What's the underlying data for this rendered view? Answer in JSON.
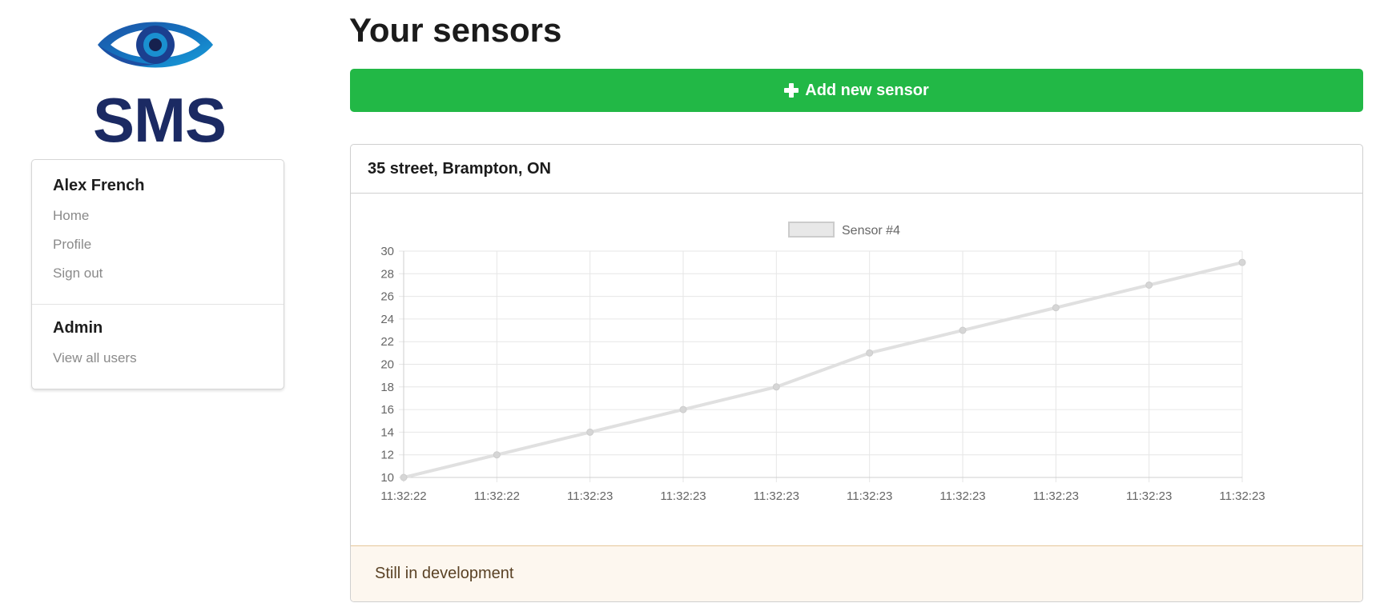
{
  "logo": {
    "text": "SMS",
    "icon": "eye-icon"
  },
  "sidebar": {
    "user_name": "Alex French",
    "links": [
      "Home",
      "Profile",
      "Sign out"
    ],
    "admin_title": "Admin",
    "admin_links": [
      "View all users"
    ]
  },
  "main": {
    "title": "Your sensors",
    "add_button": {
      "label": "Add new sensor",
      "icon": "plus-icon",
      "color": "#22b846"
    }
  },
  "sensor": {
    "location": "35 street, Brampton, ON",
    "note": "Still in development"
  },
  "chart_data": {
    "type": "line",
    "x": [
      "11:32:22",
      "11:32:22",
      "11:32:23",
      "11:32:23",
      "11:32:23",
      "11:32:23",
      "11:32:23",
      "11:32:23",
      "11:32:23",
      "11:32:23"
    ],
    "series": [
      {
        "name": "Sensor #4",
        "values": [
          10,
          12,
          14,
          16,
          18,
          21,
          23,
          25,
          27,
          29
        ],
        "color": "#e0e0e0"
      }
    ],
    "ylim": [
      10,
      30
    ],
    "yticks": [
      10,
      12,
      14,
      16,
      18,
      20,
      22,
      24,
      26,
      28,
      30
    ],
    "grid": true,
    "legend": "top-center"
  }
}
